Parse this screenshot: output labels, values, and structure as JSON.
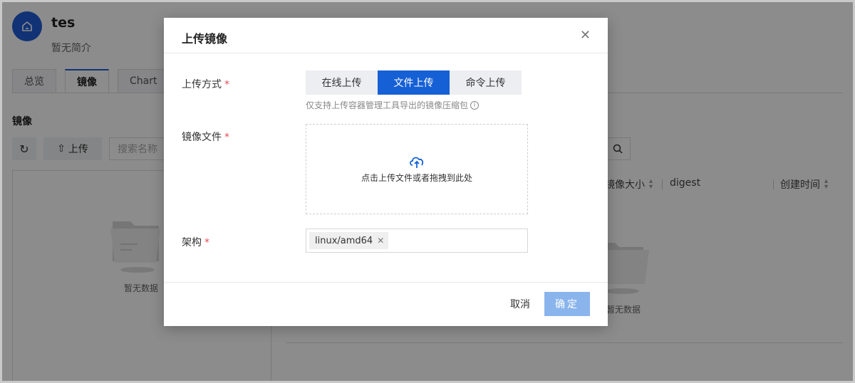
{
  "project": {
    "name": "tes",
    "description": "暂无简介"
  },
  "tabs": [
    {
      "label": "总览",
      "active": false
    },
    {
      "label": "镜像",
      "active": true
    },
    {
      "label": "Chart",
      "active": false
    }
  ],
  "images_section": {
    "title": "镜像",
    "upload_label": "上传",
    "search_placeholder": "搜索名称",
    "left_empty_text": "暂无数据",
    "columns": [
      "镜像大小",
      "digest",
      "创建时间"
    ],
    "right_empty_text": "暂无数据"
  },
  "modal": {
    "title": "上传镜像",
    "method_label": "上传方式",
    "methods": [
      {
        "label": "在线上传",
        "active": false
      },
      {
        "label": "文件上传",
        "active": true
      },
      {
        "label": "命令上传",
        "active": false
      }
    ],
    "method_tip": "仅支持上传容器管理工具导出的镜像压缩包",
    "file_label": "镜像文件",
    "dropzone_text": "点击上传文件或者拖拽到此处",
    "arch_label": "架构",
    "arch_tags": [
      "linux/amd64"
    ],
    "cancel_label": "取消",
    "ok_label": "确定",
    "required_mark": "*"
  },
  "colors": {
    "primary": "#1660d6",
    "primary_disabled": "#8ab4ec",
    "required": "#e34d59"
  }
}
